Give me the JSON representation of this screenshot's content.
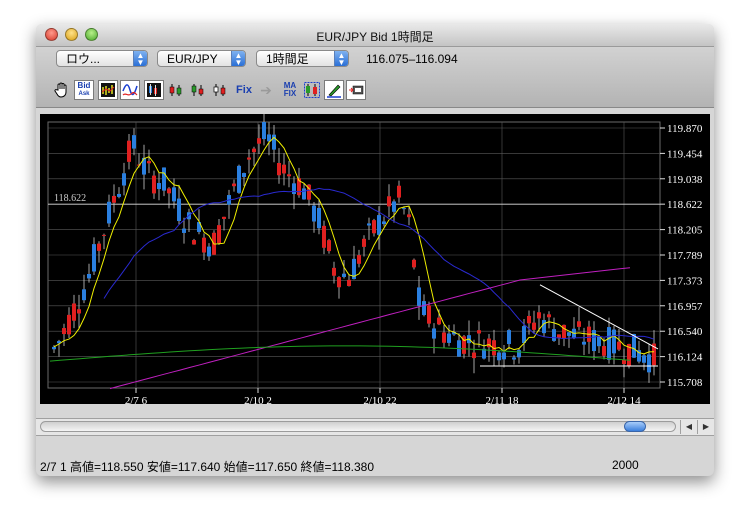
{
  "window": {
    "title": "EUR/JPY Bid 1時間足"
  },
  "toolbar": {
    "user_select": "ロウ...",
    "pair_select": "EUR/JPY",
    "period_select": "1時間足",
    "range": "116.075–116.094",
    "icons": [
      "hand-tool-icon",
      "bid-ask-icon",
      "chart-type-bar-icon",
      "indicator-wave-icon",
      "candlestick-icon",
      "candlestick-red-icon",
      "candlestick-green-icon",
      "candlestick-mixed-icon",
      "fix-icon",
      "arrow-icon",
      "ma-fix-icon",
      "candle-select-icon",
      "pencil-draw-icon",
      "print-icon"
    ],
    "bid_label_top": "Bid",
    "bid_label_bottom": "Ask",
    "fix_label": "Fix",
    "ma_label": "MA",
    "ma_fix_label": "FIX"
  },
  "chart_data": {
    "type": "candlestick",
    "price_levels": [
      "119.870",
      "119.454",
      "119.038",
      "118.622",
      "118.205",
      "117.789",
      "117.373",
      "116.957",
      "116.540",
      "116.124",
      "115.708"
    ],
    "ylim": [
      115.708,
      119.87
    ],
    "time_labels": [
      "2/7 6",
      "2/10 2",
      "2/10 22",
      "2/11 18",
      "2/12 14"
    ],
    "horizontal_line_label": "118.622",
    "horizontal_line_value": 118.622,
    "colors": {
      "up": "#2a7fe0",
      "down": "#e02020",
      "ma_short": "#f0f000",
      "ma_mid": "#2a2ad0",
      "ma_long": "#c020c0",
      "ma_longest": "#20a020",
      "grid": "#5a5a5a",
      "trend": "#ffffff"
    }
  },
  "status": {
    "info": "2/7 1  高値=118.550 安値=117.640 始値=117.650 終値=118.380",
    "count": "2000"
  }
}
